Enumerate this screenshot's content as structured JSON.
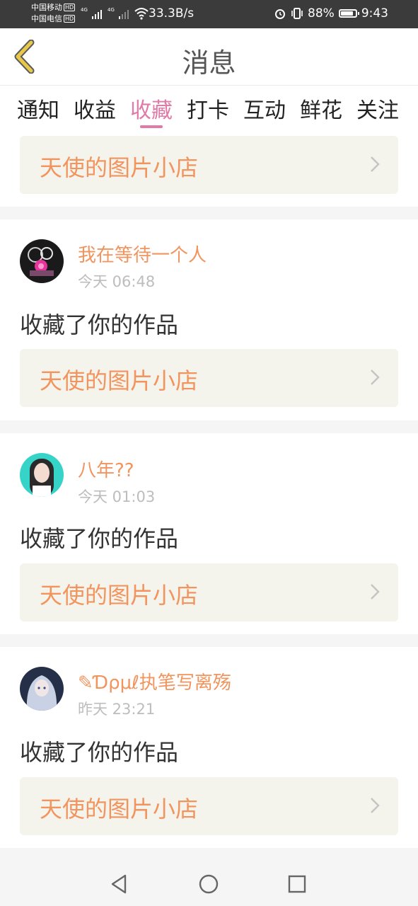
{
  "status_bar": {
    "carrier1": "中国移动",
    "carrier2": "中国电信",
    "hd": "HD",
    "net_type": "4G",
    "speed": "33.3B/s",
    "battery": "88%",
    "time": "9:43"
  },
  "header": {
    "title": "消息",
    "back_icon": "chevron-left-icon",
    "accent_color": "#e8c84a"
  },
  "tabs": [
    {
      "label": "通知",
      "active": false
    },
    {
      "label": "收益",
      "active": false
    },
    {
      "label": "收藏",
      "active": true
    },
    {
      "label": "打卡",
      "active": false
    },
    {
      "label": "互动",
      "active": false
    },
    {
      "label": "鲜花",
      "active": false
    },
    {
      "label": "关注",
      "active": false
    }
  ],
  "colors": {
    "active_tab": "#e07aa8",
    "username": "#f2945e",
    "link_bg": "#f4f3ec"
  },
  "top_partial": {
    "link_title": "天使的图片小店"
  },
  "items": [
    {
      "username": "我在等待一个人",
      "time": "今天 06:48",
      "action": "收藏了你的作品",
      "link_title": "天使的图片小店"
    },
    {
      "username": "八年??",
      "time": "今天 01:03",
      "action": "收藏了你的作品",
      "link_title": "天使的图片小店"
    },
    {
      "username": "✎Ɗρμℓ执笔写离殇",
      "time": "昨天 23:21",
      "action": "收藏了你的作品",
      "link_title": "天使的图片小店"
    }
  ],
  "nav_bar": {
    "back_icon": "triangle-back-icon",
    "home_icon": "circle-home-icon",
    "recents_icon": "square-recents-icon"
  }
}
